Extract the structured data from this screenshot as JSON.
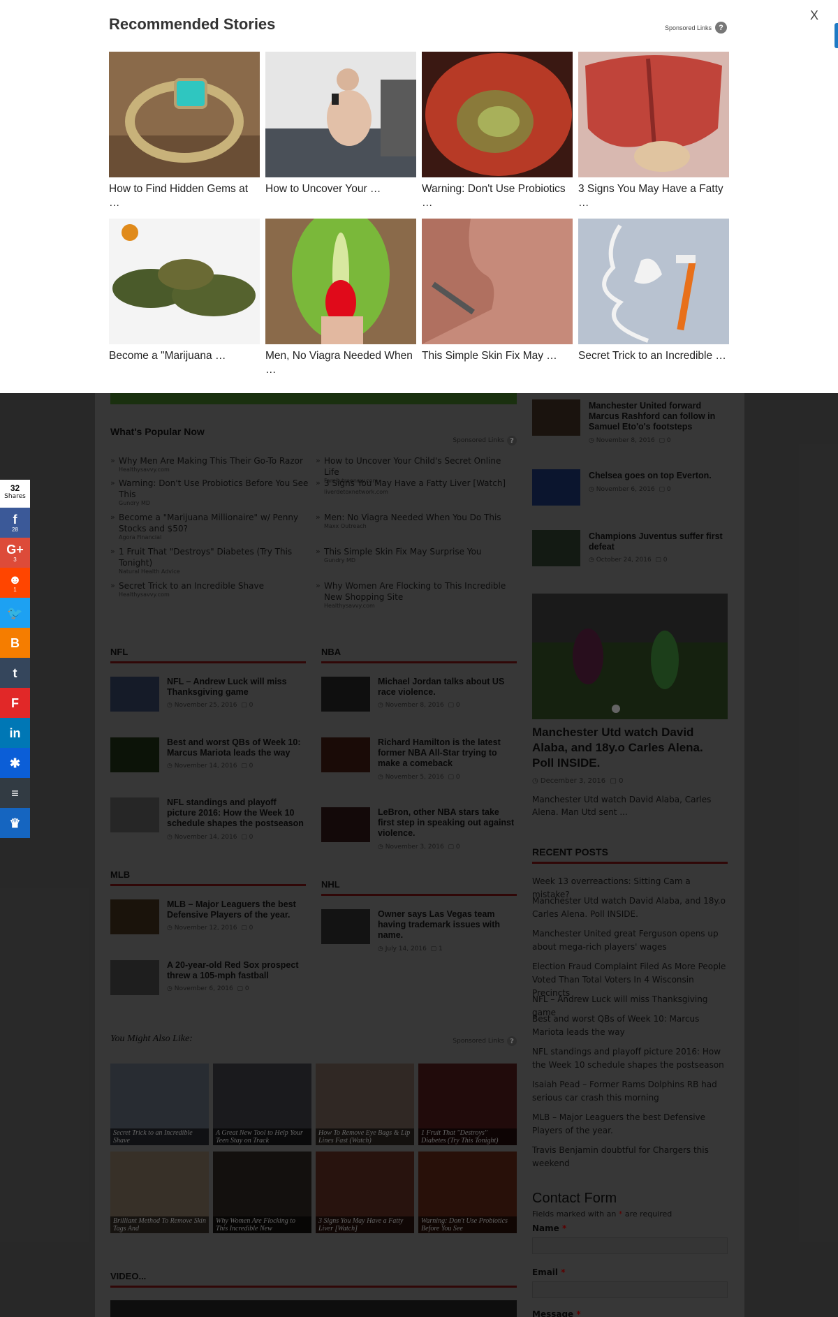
{
  "modal": {
    "title": "Recommended Stories",
    "sponsored": "Sponsored Links",
    "help_glyph": "?",
    "close": "X",
    "stories": [
      {
        "caption": "How to Find Hidden Gems at …",
        "icon": "ring-gem-image"
      },
      {
        "caption": "How to Uncover Your …",
        "icon": "man-phone-bed-image"
      },
      {
        "caption": "Warning: Don't Use Probiotics …",
        "icon": "tomato-image"
      },
      {
        "caption": "3 Signs You May Have a Fatty …",
        "icon": "liver-image"
      },
      {
        "caption": "Become a \"Marijuana …",
        "icon": "cannabis-image"
      },
      {
        "caption": "Men, No Viagra Needed When …",
        "icon": "kiwi-image"
      },
      {
        "caption": "This Simple Skin Fix May …",
        "icon": "skin-tag-image"
      },
      {
        "caption": "Secret Trick to an Incredible …",
        "icon": "razor-foam-image"
      }
    ]
  },
  "popular": {
    "title": "What's Popular Now",
    "sponsored": "Sponsored Links",
    "left": [
      {
        "title": "Why Men Are Making This Their Go-To Razor",
        "source": "Healthysavvy.com"
      },
      {
        "title": "Warning: Don't Use Probiotics Before You See This",
        "source": "Gundry MD"
      },
      {
        "title": "Become a \"Marijuana Millionaire\" w/ Penny Stocks and $50?",
        "source": "Agora Financial"
      },
      {
        "title": "1 Fruit That \"Destroys\" Diabetes (Try This Tonight)",
        "source": "Natural Health Advice"
      },
      {
        "title": "Secret Trick to an Incredible Shave",
        "source": "Healthysavvy.com"
      }
    ],
    "right": [
      {
        "title": "How to Uncover Your Child's Secret Online Life",
        "source": "Familytreenow.com"
      },
      {
        "title": "3 Signs You May Have a Fatty Liver [Watch]",
        "source": "liverdetoxnetwork.com"
      },
      {
        "title": "Men: No Viagra Needed When You Do This",
        "source": "Maxx Outreach"
      },
      {
        "title": "This Simple Skin Fix May Surprise You",
        "source": "Gundry MD"
      },
      {
        "title": "Why Women Are Flocking to This Incredible New Shopping Site",
        "source": "Healthysavvy.com"
      }
    ]
  },
  "categories": {
    "nfl": {
      "title": "NFL",
      "posts": [
        {
          "title": "NFL – Andrew Luck will miss Thanksgiving game",
          "date": "November 25, 2016",
          "comments": "0"
        },
        {
          "title": "Best and worst QBs of Week 10: Marcus Mariota leads the way",
          "date": "November 14, 2016",
          "comments": "0"
        },
        {
          "title": "NFL standings and playoff picture 2016: How the Week 10 schedule shapes the postseason",
          "date": "November 14, 2016",
          "comments": "0"
        }
      ]
    },
    "nba": {
      "title": "NBA",
      "posts": [
        {
          "title": "Michael Jordan talks about US race violence.",
          "date": "November 8, 2016",
          "comments": "0"
        },
        {
          "title": "Richard Hamilton is the latest former NBA All-Star trying to make a comeback",
          "date": "November 5, 2016",
          "comments": "0"
        },
        {
          "title": "LeBron, other NBA stars take first step in speaking out against violence.",
          "date": "November 3, 2016",
          "comments": "0"
        }
      ]
    },
    "mlb": {
      "title": "MLB",
      "posts": [
        {
          "title": "MLB – Major Leaguers the best Defensive Players of the year.",
          "date": "November 12, 2016",
          "comments": "0"
        },
        {
          "title": "A 20-year-old Red Sox prospect threw a 105-mph fastball",
          "date": "November 6, 2016",
          "comments": "0"
        }
      ]
    },
    "nhl": {
      "title": "NHL",
      "posts": [
        {
          "title": "Owner says Las Vegas team having trademark issues with name.",
          "date": "July 14, 2016",
          "comments": "1"
        }
      ]
    }
  },
  "also": {
    "title": "You Might Also Like:",
    "sponsored": "Sponsored Links",
    "tiles": [
      "Secret Trick to an Incredible Shave",
      "A Great New Tool to Help Your Teen Stay on Track",
      "How To Remove Eye Bags & Lip Lines Fast (Watch)",
      "1 Fruit That \"Destroys\" Diabetes (Try This Tonight)",
      "Brilliant Method To Remove Skin Tags And",
      "Why Women Are Flocking to This Incredible New",
      "3 Signs You May Have a Fatty Liver [Watch]",
      "Warning: Don't Use Probiotics Before You See"
    ]
  },
  "video": {
    "title": "VIDEO..."
  },
  "sidebar": {
    "top_posts": [
      {
        "title": "Manchester United forward Marcus Rashford can follow in Samuel Eto'o's footsteps",
        "date": "November 8, 2016",
        "comments": "0"
      },
      {
        "title": "Chelsea goes on top Everton.",
        "date": "November 6, 2016",
        "comments": "0"
      },
      {
        "title": "Champions Juventus suffer first defeat",
        "date": "October 24, 2016",
        "comments": "0"
      }
    ],
    "feature": {
      "title": "Manchester Utd watch David Alaba, and 18y.o Carles Alena. Poll INSIDE.",
      "date": "December 3, 2016",
      "comments": "0",
      "excerpt": "Manchester Utd watch David Alaba, Carles Alena. Man Utd sent ..."
    },
    "recent_title": "RECENT POSTS",
    "recent": [
      "Week 13 overreactions: Sitting Cam a mistake?",
      "Manchester Utd watch David Alaba, and 18y.o Carles Alena. Poll INSIDE.",
      "Manchester United great Ferguson opens up about mega-rich players' wages",
      "Election Fraud Complaint Filed As More People Voted Than Total Voters In 4 Wisconsin Precincts",
      "NFL – Andrew Luck will miss Thanksgiving game",
      "Best and worst QBs of Week 10: Marcus Mariota leads the way",
      "NFL standings and playoff picture 2016: How the Week 10 schedule shapes the postseason",
      "Isaiah Pead – Former Rams Dolphins RB had serious car crash this morning",
      "MLB – Major Leaguers the best Defensive Players of the year.",
      "Travis Benjamin doubtful for Chargers this weekend"
    ],
    "contact": {
      "title": "Contact Form",
      "note_before": "Fields marked with an",
      "asterisk": "*",
      "note_after": "are required",
      "name_label": "Name",
      "email_label": "Email",
      "message_label": "Message"
    }
  },
  "share": {
    "total": "32",
    "total_label": "Shares",
    "buttons": [
      {
        "name": "facebook",
        "glyph": "f",
        "count": "28",
        "color": "#3b5998"
      },
      {
        "name": "google-plus",
        "glyph": "G+",
        "count": "3",
        "color": "#dd4b39"
      },
      {
        "name": "reddit",
        "glyph": "☻",
        "count": "1",
        "color": "#ff4500"
      },
      {
        "name": "twitter",
        "glyph": "🐦",
        "count": "",
        "color": "#1da1f2"
      },
      {
        "name": "blogger",
        "glyph": "B",
        "count": "",
        "color": "#f57d00"
      },
      {
        "name": "tumblr",
        "glyph": "t",
        "count": "",
        "color": "#35465c"
      },
      {
        "name": "flipboard",
        "glyph": "F",
        "count": "",
        "color": "#e12828"
      },
      {
        "name": "linkedin",
        "glyph": "in",
        "count": "",
        "color": "#0077b5"
      },
      {
        "name": "pinboard",
        "glyph": "✱",
        "count": "",
        "color": "#0b5ed7"
      },
      {
        "name": "buffer",
        "glyph": "≡",
        "count": "",
        "color": "#323b43"
      },
      {
        "name": "sumome",
        "glyph": "♛",
        "count": "",
        "color": "#1565c0"
      }
    ]
  }
}
